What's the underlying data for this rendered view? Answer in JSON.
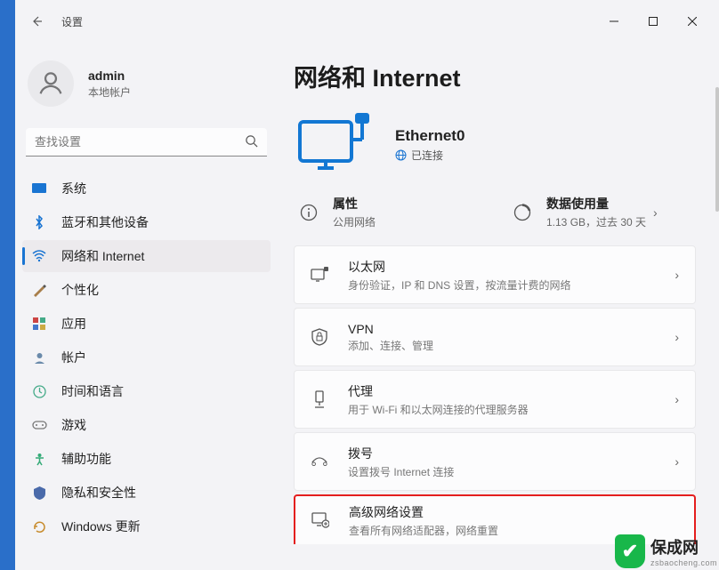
{
  "window": {
    "title": "设置"
  },
  "user": {
    "name": "admin",
    "subtitle": "本地帐户"
  },
  "search": {
    "placeholder": "查找设置"
  },
  "sidebar": {
    "items": [
      {
        "label": "系统",
        "icon": "system-icon"
      },
      {
        "label": "蓝牙和其他设备",
        "icon": "bluetooth-icon"
      },
      {
        "label": "网络和 Internet",
        "icon": "network-icon"
      },
      {
        "label": "个性化",
        "icon": "personalize-icon"
      },
      {
        "label": "应用",
        "icon": "apps-icon"
      },
      {
        "label": "帐户",
        "icon": "accounts-icon"
      },
      {
        "label": "时间和语言",
        "icon": "time-icon"
      },
      {
        "label": "游戏",
        "icon": "gaming-icon"
      },
      {
        "label": "辅助功能",
        "icon": "accessibility-icon"
      },
      {
        "label": "隐私和安全性",
        "icon": "privacy-icon"
      },
      {
        "label": "Windows 更新",
        "icon": "update-icon"
      }
    ],
    "active_index": 2
  },
  "page": {
    "title": "网络和 Internet",
    "connection": {
      "name": "Ethernet0",
      "status": "已连接"
    },
    "quick": {
      "properties": {
        "title": "属性",
        "subtitle": "公用网络"
      },
      "usage": {
        "title": "数据使用量",
        "subtitle": "1.13 GB，过去 30 天"
      }
    },
    "cards": [
      {
        "title": "以太网",
        "subtitle": "身份验证，IP 和 DNS 设置，按流量计费的网络",
        "icon": "ethernet-icon"
      },
      {
        "title": "VPN",
        "subtitle": "添加、连接、管理",
        "icon": "vpn-icon"
      },
      {
        "title": "代理",
        "subtitle": "用于 Wi-Fi 和以太网连接的代理服务器",
        "icon": "proxy-icon"
      },
      {
        "title": "拨号",
        "subtitle": "设置拨号 Internet 连接",
        "icon": "dialup-icon"
      },
      {
        "title": "高级网络设置",
        "subtitle": "查看所有网络适配器，网络重置",
        "icon": "advanced-icon"
      }
    ]
  },
  "watermark": {
    "name": "保成网",
    "url": "zsbaocheng.com"
  }
}
